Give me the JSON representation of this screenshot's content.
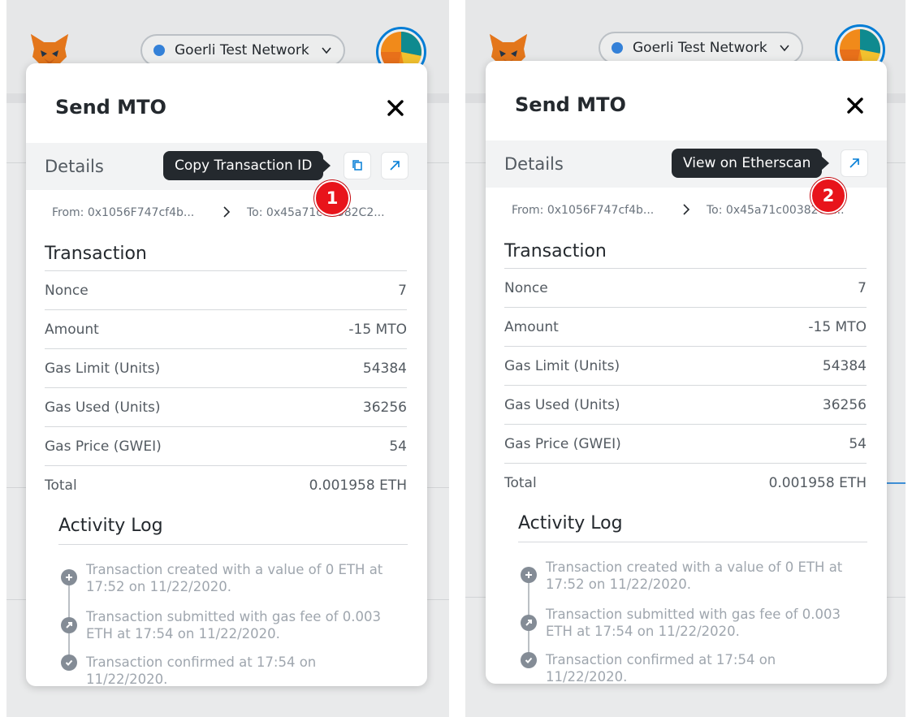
{
  "panels": [
    {
      "network": {
        "label": "Goerli Test Network"
      },
      "modal": {
        "title": "Send MTO",
        "details_label": "Details",
        "tooltip": "Copy Transaction ID",
        "badge": "1",
        "from": "From: 0x1056F747cf4b...",
        "to": "To: 0x45a71c00382C2...",
        "transaction_title": "Transaction",
        "rows": [
          {
            "label": "Nonce",
            "value": "7"
          },
          {
            "label": "Amount",
            "value": "-15 MTO"
          },
          {
            "label": "Gas Limit (Units)",
            "value": "54384"
          },
          {
            "label": "Gas Used (Units)",
            "value": "36256"
          },
          {
            "label": "Gas Price (GWEI)",
            "value": "54"
          },
          {
            "label": "Total",
            "value": "0.001958 ETH"
          }
        ],
        "activity_title": "Activity Log",
        "log": [
          {
            "icon": "plus-icon",
            "text": "Transaction created with a value of 0 ETH at 17:52 on 11/22/2020."
          },
          {
            "icon": "submit-arrow-icon",
            "text": "Transaction submitted with gas fee of 0.003 ETH at 17:54 on 11/22/2020."
          },
          {
            "icon": "check-icon",
            "text": "Transaction confirmed at 17:54 on 11/22/2020."
          }
        ]
      }
    },
    {
      "network": {
        "label": "Goerli Test Network"
      },
      "modal": {
        "title": "Send MTO",
        "details_label": "Details",
        "tooltip": "View on Etherscan",
        "badge": "2",
        "from": "From: 0x1056F747cf4b...",
        "to": "To: 0x45a71c00382C2...",
        "transaction_title": "Transaction",
        "rows": [
          {
            "label": "Nonce",
            "value": "7"
          },
          {
            "label": "Amount",
            "value": "-15 MTO"
          },
          {
            "label": "Gas Limit (Units)",
            "value": "54384"
          },
          {
            "label": "Gas Used (Units)",
            "value": "36256"
          },
          {
            "label": "Gas Price (GWEI)",
            "value": "54"
          },
          {
            "label": "Total",
            "value": "0.001958 ETH"
          }
        ],
        "activity_title": "Activity Log",
        "log": [
          {
            "icon": "plus-icon",
            "text": "Transaction created with a value of 0 ETH at 17:52 on 11/22/2020."
          },
          {
            "icon": "submit-arrow-icon",
            "text": "Transaction submitted with gas fee of 0.003 ETH at 17:54 on 11/22/2020."
          },
          {
            "icon": "check-icon",
            "text": "Transaction confirmed at 17:54 on 11/22/2020."
          }
        ]
      }
    }
  ],
  "colors": {
    "accent": "#037dd6",
    "badge": "#e8141b",
    "tooltip": "#24292e",
    "network_dot": "#3481d8"
  }
}
